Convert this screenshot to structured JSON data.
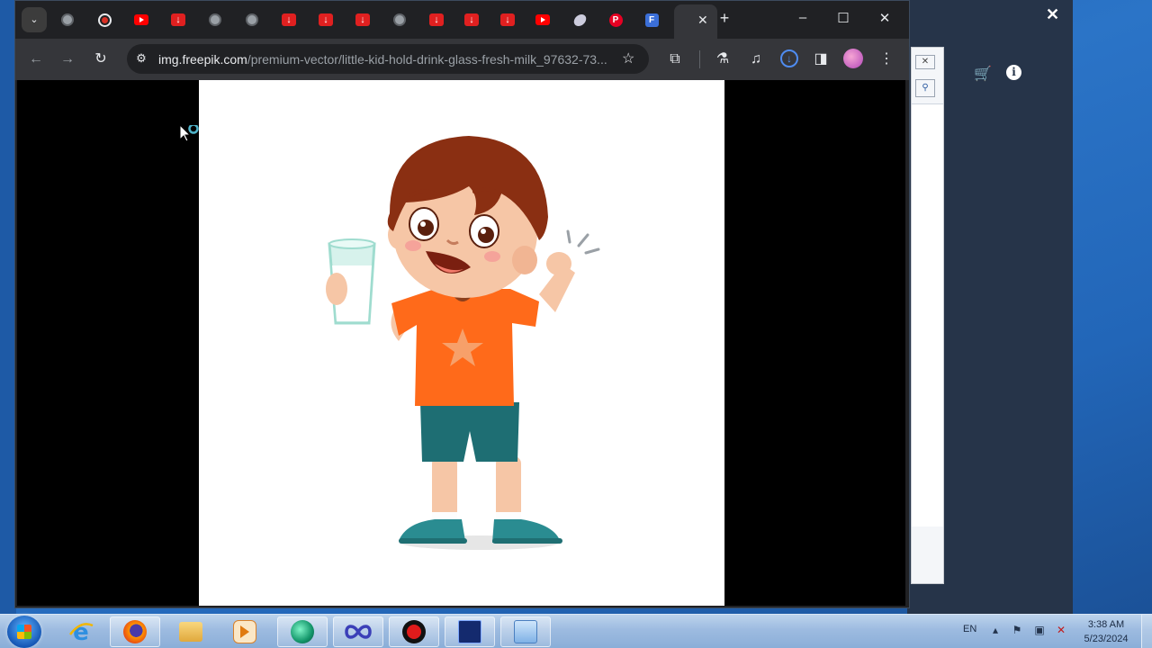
{
  "browser": {
    "url_host": "img.freepik.com",
    "url_path": "/premium-vector/little-kid-hold-drink-glass-fresh-milk_97632-73...",
    "tabs": [
      {
        "icon": "globe-icon"
      },
      {
        "icon": "record-icon"
      },
      {
        "icon": "youtube-icon"
      },
      {
        "icon": "download-icon"
      },
      {
        "icon": "globe-icon"
      },
      {
        "icon": "globe-icon"
      },
      {
        "icon": "download-icon"
      },
      {
        "icon": "download-icon"
      },
      {
        "icon": "download-icon"
      },
      {
        "icon": "globe-icon"
      },
      {
        "icon": "download-icon"
      },
      {
        "icon": "download-icon"
      },
      {
        "icon": "download-icon"
      },
      {
        "icon": "youtube-icon"
      },
      {
        "icon": "cut-icon"
      },
      {
        "icon": "pinterest-icon"
      },
      {
        "icon": "docs-icon"
      }
    ],
    "active_tab_icon": "close-icon",
    "page_background": "#000000",
    "image_background": "#ffffff"
  },
  "taskbar": {
    "language": "EN",
    "time": "3:38 AM",
    "date": "5/23/2024",
    "apps": [
      "internet-explorer",
      "firefox",
      "file-explorer",
      "media-player",
      "browser-sphere",
      "infinity-app",
      "record-app",
      "code-app",
      "control-panel"
    ]
  },
  "background_app": {
    "accent": "#263449"
  }
}
